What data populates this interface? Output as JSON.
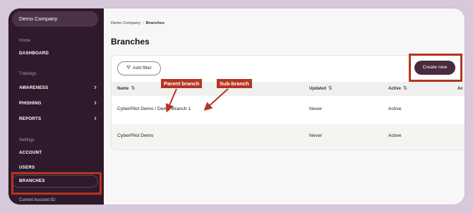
{
  "sidebar": {
    "company": "Demo Company",
    "sections": {
      "home": "Home",
      "trainings": "Trainings",
      "settings": "Settings"
    },
    "items": {
      "dashboard": "DASHBOARD",
      "awareness": "AWARENESS",
      "phishing": "PHISHING",
      "reports": "REPORTS",
      "account": "ACCOUNT",
      "users": "USERS",
      "branches": "BRANCHES"
    },
    "footer": "Current Account ID:"
  },
  "breadcrumb": {
    "parent": "Demo Company",
    "current": "Branches"
  },
  "page_title": "Branches",
  "toolbar": {
    "add_filter": "Add filter",
    "create_new": "Create new"
  },
  "table": {
    "headers": {
      "name": "Name",
      "updated": "Updated",
      "active": "Active",
      "extra": "Ac"
    },
    "rows": [
      {
        "name": "CyberPilot Demo / Demo Branch 1",
        "updated": "Never",
        "active": "Active"
      },
      {
        "name": "CyberPilot Demo",
        "updated": "Never",
        "active": "Active"
      }
    ]
  },
  "annotations": {
    "parent": "Parent branch",
    "sub": "Sub-branch"
  },
  "colors": {
    "sidebar": "#2e1a2c",
    "accent": "#4a2a40",
    "highlight": "#b53520"
  }
}
